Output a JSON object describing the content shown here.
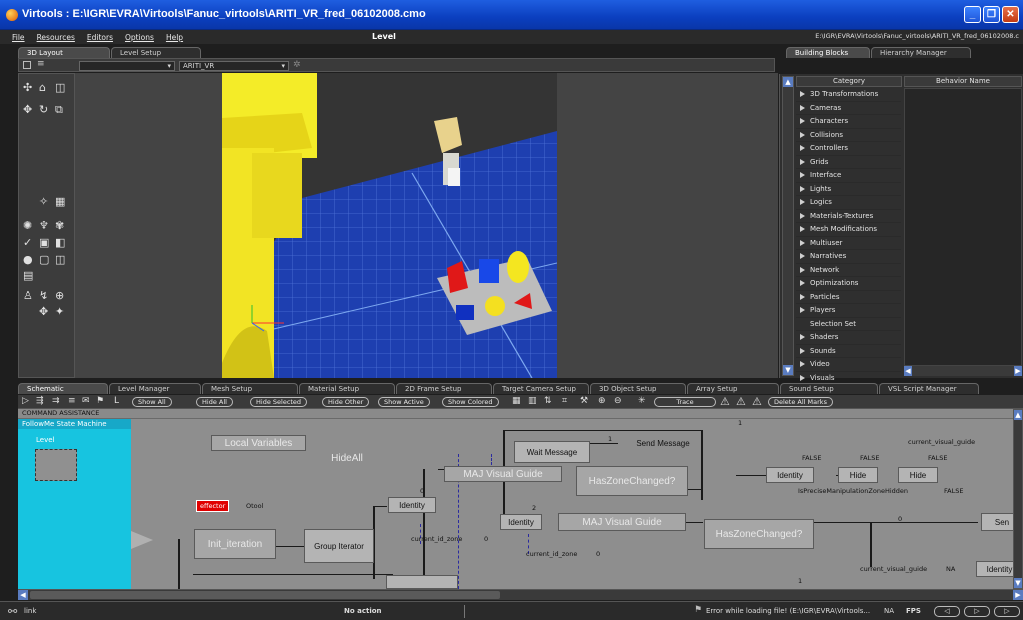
{
  "window": {
    "title": "Virtools : E:\\IGR\\EVRA\\Virtools\\Fanuc_virtools\\ARITI_VR_fred_06102008.cmo",
    "buttons": [
      "_",
      "❐",
      "✕"
    ]
  },
  "menubar": {
    "items": [
      "File",
      "Resources",
      "Editors",
      "Options",
      "Help"
    ],
    "center_label": "Level",
    "path": "E:\\IGR\\EVRA\\Virtools\\Fanuc_virtools\\ARITI_VR_fred_06102008.c"
  },
  "top_tabs": {
    "left": [
      "3D Layout",
      "Level Setup"
    ],
    "right": [
      "Building Blocks",
      "Hierarchy Manager"
    ]
  },
  "viewport_toolbar": {
    "camera_select": "ARITI_VR"
  },
  "building_blocks": {
    "header_category": "Category",
    "header_behavior": "Behavior Name",
    "categories": [
      {
        "label": "3D Transformations",
        "expandable": true
      },
      {
        "label": "Cameras",
        "expandable": true
      },
      {
        "label": "Characters",
        "expandable": true
      },
      {
        "label": "Collisions",
        "expandable": true
      },
      {
        "label": "Controllers",
        "expandable": true
      },
      {
        "label": "Grids",
        "expandable": true
      },
      {
        "label": "Interface",
        "expandable": true
      },
      {
        "label": "Lights",
        "expandable": true
      },
      {
        "label": "Logics",
        "expandable": true
      },
      {
        "label": "Materials-Textures",
        "expandable": true
      },
      {
        "label": "Mesh Modifications",
        "expandable": true
      },
      {
        "label": "Multiuser",
        "expandable": true
      },
      {
        "label": "Narratives",
        "expandable": true
      },
      {
        "label": "Network",
        "expandable": true
      },
      {
        "label": "Optimizations",
        "expandable": true
      },
      {
        "label": "Particles",
        "expandable": true
      },
      {
        "label": "Players",
        "expandable": true
      },
      {
        "label": "Selection Set",
        "expandable": false
      },
      {
        "label": "Shaders",
        "expandable": true
      },
      {
        "label": "Sounds",
        "expandable": true
      },
      {
        "label": "Video",
        "expandable": true
      },
      {
        "label": "Visuals",
        "expandable": true
      }
    ]
  },
  "bottom_tabs": [
    "Schematic",
    "Level Manager",
    "Mesh Setup",
    "Material Setup",
    "2D Frame Setup",
    "Target Camera Setup",
    "3D Object Setup",
    "Array Setup",
    "Sound Setup",
    "VSL Script Manager"
  ],
  "schematic_toolbar": {
    "buttons": [
      "Show All",
      "Hide All",
      "Hide Selected",
      "Hide Other",
      "Show Active",
      "Show Colored",
      "Trace",
      "Delete All Marks"
    ]
  },
  "schematic": {
    "command_row": "COMMAND ASSISTANCE",
    "script_header": "FollowMe State Machine",
    "level_label": "Level",
    "blocks": {
      "local_variables": "Local Variables",
      "hide_all": "HideAll",
      "wait_message": "Wait Message",
      "send_message_1": "Send Message",
      "maj_visual_guide_1": "MAJ Visual Guide",
      "has_zone_changed_1": "HasZoneChanged?",
      "identity_1": "Identity",
      "identity_2": "Identity",
      "identity_3": "Identity",
      "identity_4": "Identity",
      "hide_1": "Hide",
      "hide_2": "Hide",
      "maj_visual_guide_2": "MAJ Visual Guide",
      "has_zone_changed_2": "HasZoneChanged?",
      "init_iteration": "Init_iteration",
      "group_iterator": "Group Iterator",
      "send_message_2": "Sen"
    },
    "effector": {
      "tag": "effector",
      "value": "Otool"
    },
    "labels": {
      "current_visual_guide": "current_visual_guide",
      "false_1": "FALSE",
      "false_2": "FALSE",
      "false_3": "FALSE",
      "false_4": "FALSE",
      "is_precise": "IsPreciseManipulationZoneHidden",
      "current_id_zone_1": "current_id_zone",
      "current_id_zone_2": "current_id_zone",
      "zero_1": "0",
      "zero_2": "0",
      "zero_3": "0",
      "zero_4": "0",
      "one_1": "1",
      "one_2": "1",
      "one_3": "1",
      "two": "2",
      "current_visual_guide_na": "current_visual_guide",
      "na": "NA"
    }
  },
  "statusbar": {
    "link": "link",
    "action": "No action",
    "error": "Error while loading file! (E:\\IGR\\EVRA\\Virtools...",
    "na": "NA",
    "fps": "FPS"
  }
}
